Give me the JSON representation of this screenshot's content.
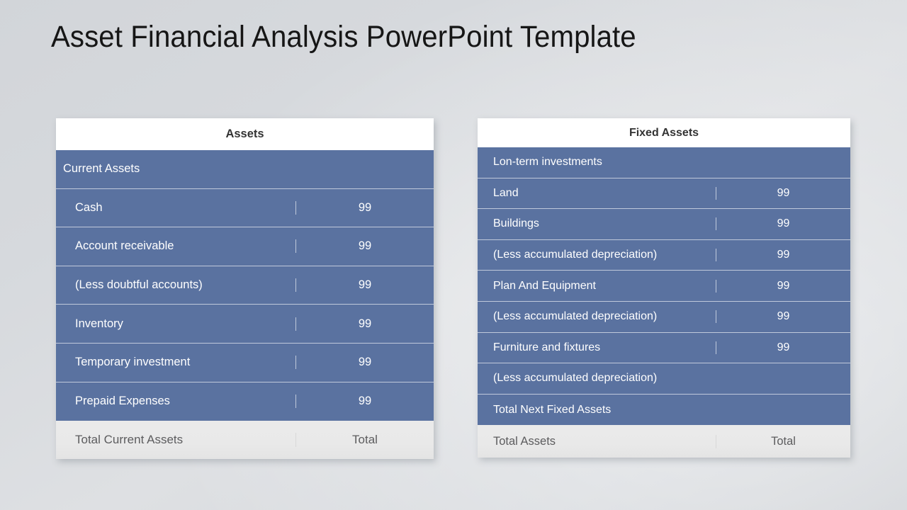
{
  "slide": {
    "title": "Asset Financial Analysis PowerPoint Template",
    "background_color": "#d6d9dd",
    "accent_color": "#5a72a0",
    "footer_color": "#e9e9e9"
  },
  "tables": [
    {
      "id": "assets",
      "header": "Assets",
      "rows": [
        {
          "label": "Current Assets",
          "value": "",
          "section": true
        },
        {
          "label": "Cash",
          "value": "99"
        },
        {
          "label": "Account receivable",
          "value": "99"
        },
        {
          "label": "(Less doubtful accounts)",
          "value": "99"
        },
        {
          "label": "Inventory",
          "value": "99"
        },
        {
          "label": "Temporary investment",
          "value": "99"
        },
        {
          "label": "Prepaid Expenses",
          "value": "99"
        }
      ],
      "footer": {
        "label": "Total Current Assets",
        "value": "Total"
      }
    },
    {
      "id": "fixed-assets",
      "header": "Fixed Assets",
      "rows": [
        {
          "label": "Lon-term investments",
          "value": ""
        },
        {
          "label": "Land",
          "value": "99"
        },
        {
          "label": "Buildings",
          "value": "99"
        },
        {
          "label": "(Less accumulated depreciation)",
          "value": "99"
        },
        {
          "label": "Plan And Equipment",
          "value": "99"
        },
        {
          "label": "(Less accumulated depreciation)",
          "value": "99"
        },
        {
          "label": "Furniture and fixtures",
          "value": "99"
        },
        {
          "label": "(Less accumulated depreciation)",
          "value": ""
        },
        {
          "label": "Total Next Fixed Assets",
          "value": ""
        }
      ],
      "footer": {
        "label": "Total Assets",
        "value": "Total"
      }
    }
  ]
}
